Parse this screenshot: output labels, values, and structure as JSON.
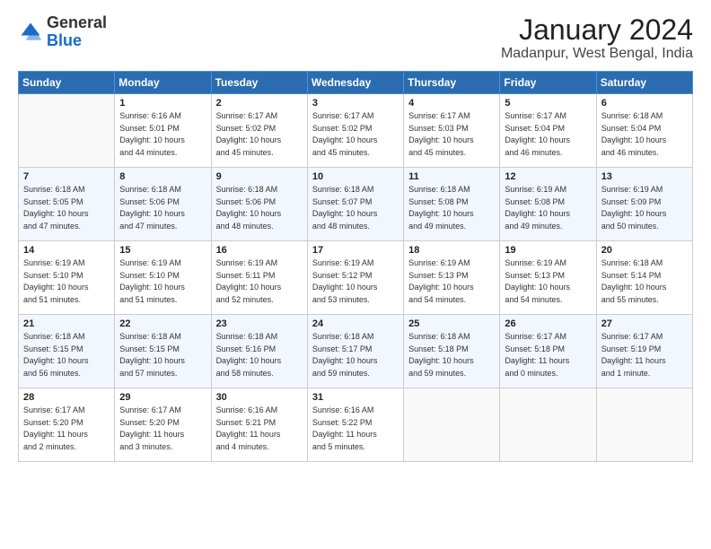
{
  "header": {
    "logo_general": "General",
    "logo_blue": "Blue",
    "month": "January 2024",
    "location": "Madanpur, West Bengal, India"
  },
  "columns": [
    "Sunday",
    "Monday",
    "Tuesday",
    "Wednesday",
    "Thursday",
    "Friday",
    "Saturday"
  ],
  "weeks": [
    {
      "days": [
        {
          "num": "",
          "info": ""
        },
        {
          "num": "1",
          "info": "Sunrise: 6:16 AM\nSunset: 5:01 PM\nDaylight: 10 hours\nand 44 minutes."
        },
        {
          "num": "2",
          "info": "Sunrise: 6:17 AM\nSunset: 5:02 PM\nDaylight: 10 hours\nand 45 minutes."
        },
        {
          "num": "3",
          "info": "Sunrise: 6:17 AM\nSunset: 5:02 PM\nDaylight: 10 hours\nand 45 minutes."
        },
        {
          "num": "4",
          "info": "Sunrise: 6:17 AM\nSunset: 5:03 PM\nDaylight: 10 hours\nand 45 minutes."
        },
        {
          "num": "5",
          "info": "Sunrise: 6:17 AM\nSunset: 5:04 PM\nDaylight: 10 hours\nand 46 minutes."
        },
        {
          "num": "6",
          "info": "Sunrise: 6:18 AM\nSunset: 5:04 PM\nDaylight: 10 hours\nand 46 minutes."
        }
      ]
    },
    {
      "days": [
        {
          "num": "7",
          "info": "Sunrise: 6:18 AM\nSunset: 5:05 PM\nDaylight: 10 hours\nand 47 minutes."
        },
        {
          "num": "8",
          "info": "Sunrise: 6:18 AM\nSunset: 5:06 PM\nDaylight: 10 hours\nand 47 minutes."
        },
        {
          "num": "9",
          "info": "Sunrise: 6:18 AM\nSunset: 5:06 PM\nDaylight: 10 hours\nand 48 minutes."
        },
        {
          "num": "10",
          "info": "Sunrise: 6:18 AM\nSunset: 5:07 PM\nDaylight: 10 hours\nand 48 minutes."
        },
        {
          "num": "11",
          "info": "Sunrise: 6:18 AM\nSunset: 5:08 PM\nDaylight: 10 hours\nand 49 minutes."
        },
        {
          "num": "12",
          "info": "Sunrise: 6:19 AM\nSunset: 5:08 PM\nDaylight: 10 hours\nand 49 minutes."
        },
        {
          "num": "13",
          "info": "Sunrise: 6:19 AM\nSunset: 5:09 PM\nDaylight: 10 hours\nand 50 minutes."
        }
      ]
    },
    {
      "days": [
        {
          "num": "14",
          "info": "Sunrise: 6:19 AM\nSunset: 5:10 PM\nDaylight: 10 hours\nand 51 minutes."
        },
        {
          "num": "15",
          "info": "Sunrise: 6:19 AM\nSunset: 5:10 PM\nDaylight: 10 hours\nand 51 minutes."
        },
        {
          "num": "16",
          "info": "Sunrise: 6:19 AM\nSunset: 5:11 PM\nDaylight: 10 hours\nand 52 minutes."
        },
        {
          "num": "17",
          "info": "Sunrise: 6:19 AM\nSunset: 5:12 PM\nDaylight: 10 hours\nand 53 minutes."
        },
        {
          "num": "18",
          "info": "Sunrise: 6:19 AM\nSunset: 5:13 PM\nDaylight: 10 hours\nand 54 minutes."
        },
        {
          "num": "19",
          "info": "Sunrise: 6:19 AM\nSunset: 5:13 PM\nDaylight: 10 hours\nand 54 minutes."
        },
        {
          "num": "20",
          "info": "Sunrise: 6:18 AM\nSunset: 5:14 PM\nDaylight: 10 hours\nand 55 minutes."
        }
      ]
    },
    {
      "days": [
        {
          "num": "21",
          "info": "Sunrise: 6:18 AM\nSunset: 5:15 PM\nDaylight: 10 hours\nand 56 minutes."
        },
        {
          "num": "22",
          "info": "Sunrise: 6:18 AM\nSunset: 5:15 PM\nDaylight: 10 hours\nand 57 minutes."
        },
        {
          "num": "23",
          "info": "Sunrise: 6:18 AM\nSunset: 5:16 PM\nDaylight: 10 hours\nand 58 minutes."
        },
        {
          "num": "24",
          "info": "Sunrise: 6:18 AM\nSunset: 5:17 PM\nDaylight: 10 hours\nand 59 minutes."
        },
        {
          "num": "25",
          "info": "Sunrise: 6:18 AM\nSunset: 5:18 PM\nDaylight: 10 hours\nand 59 minutes."
        },
        {
          "num": "26",
          "info": "Sunrise: 6:17 AM\nSunset: 5:18 PM\nDaylight: 11 hours\nand 0 minutes."
        },
        {
          "num": "27",
          "info": "Sunrise: 6:17 AM\nSunset: 5:19 PM\nDaylight: 11 hours\nand 1 minute."
        }
      ]
    },
    {
      "days": [
        {
          "num": "28",
          "info": "Sunrise: 6:17 AM\nSunset: 5:20 PM\nDaylight: 11 hours\nand 2 minutes."
        },
        {
          "num": "29",
          "info": "Sunrise: 6:17 AM\nSunset: 5:20 PM\nDaylight: 11 hours\nand 3 minutes."
        },
        {
          "num": "30",
          "info": "Sunrise: 6:16 AM\nSunset: 5:21 PM\nDaylight: 11 hours\nand 4 minutes."
        },
        {
          "num": "31",
          "info": "Sunrise: 6:16 AM\nSunset: 5:22 PM\nDaylight: 11 hours\nand 5 minutes."
        },
        {
          "num": "",
          "info": ""
        },
        {
          "num": "",
          "info": ""
        },
        {
          "num": "",
          "info": ""
        }
      ]
    }
  ]
}
